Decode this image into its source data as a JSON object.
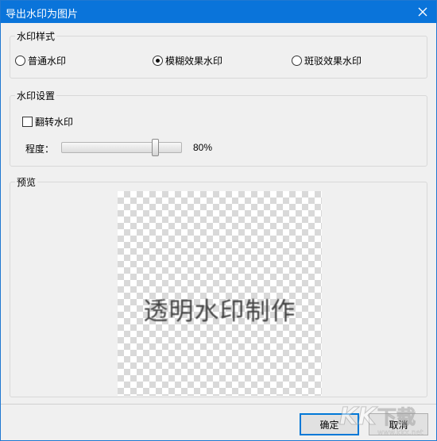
{
  "window": {
    "title": "导出水印为图片"
  },
  "style_group": {
    "label": "水印样式",
    "options": [
      {
        "label": "普通水印",
        "selected": false
      },
      {
        "label": "模糊效果水印",
        "selected": true
      },
      {
        "label": "斑驳效果水印",
        "selected": false
      }
    ]
  },
  "settings_group": {
    "label": "水印设置",
    "flip_label": "翻转水印",
    "flip_checked": false,
    "degree_label": "程度：",
    "degree_value": 0.8,
    "degree_text": "80%"
  },
  "preview_group": {
    "label": "预览",
    "watermark_text": "透明水印制作"
  },
  "footer": {
    "ok_label": "确定",
    "cancel_label": "取消"
  },
  "branding": {
    "text": "KK下载",
    "url_text": "www.kkx.net"
  },
  "icons": {
    "close": "close-icon"
  }
}
